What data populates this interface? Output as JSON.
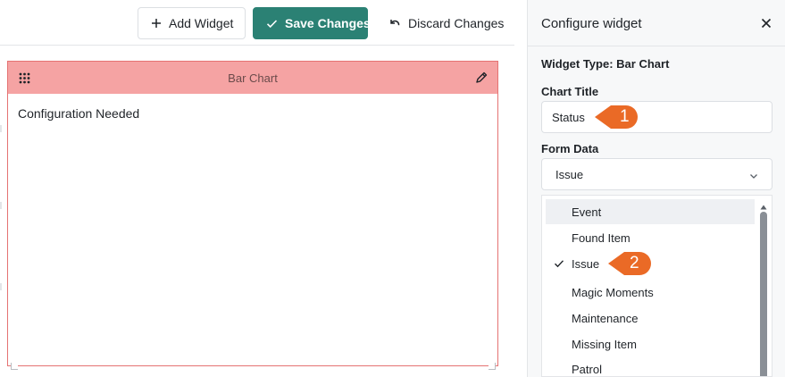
{
  "toolbar": {
    "add_widget_label": "Add Widget",
    "save_label": "Save Changes",
    "discard_label": "Discard Changes"
  },
  "widget": {
    "title": "Bar Chart",
    "body_text": "Configuration Needed"
  },
  "panel": {
    "title": "Configure widget",
    "widget_type_label": "Widget Type:",
    "widget_type_value": "Bar Chart",
    "chart_title_label": "Chart Title",
    "chart_title_value": "Status",
    "form_data_label": "Form Data",
    "form_data_value": "Issue"
  },
  "dropdown": {
    "options": [
      {
        "label": "Event",
        "selected": false,
        "highlighted": true
      },
      {
        "label": "Found Item",
        "selected": false,
        "highlighted": false
      },
      {
        "label": "Issue",
        "selected": true,
        "highlighted": false
      },
      {
        "label": "Magic Moments",
        "selected": false,
        "highlighted": false
      },
      {
        "label": "Maintenance",
        "selected": false,
        "highlighted": false
      },
      {
        "label": "Missing Item",
        "selected": false,
        "highlighted": false
      },
      {
        "label": "Patrol",
        "selected": false,
        "highlighted": false
      }
    ]
  },
  "callouts": [
    {
      "number": "1"
    },
    {
      "number": "2"
    }
  ],
  "colors": {
    "accent": "#2b8174",
    "widget_header": "#f5a3a3",
    "widget_border": "#e57373",
    "callout": "#ea6a26"
  },
  "icons": {
    "add": "plus-icon",
    "save": "check-icon",
    "discard": "undo-icon",
    "drag": "drag-grid-icon",
    "edit": "pencil-icon",
    "close": "close-icon",
    "select": "chevron-down-icon",
    "selected": "check-icon",
    "scroll": "scroll-up-icon"
  }
}
